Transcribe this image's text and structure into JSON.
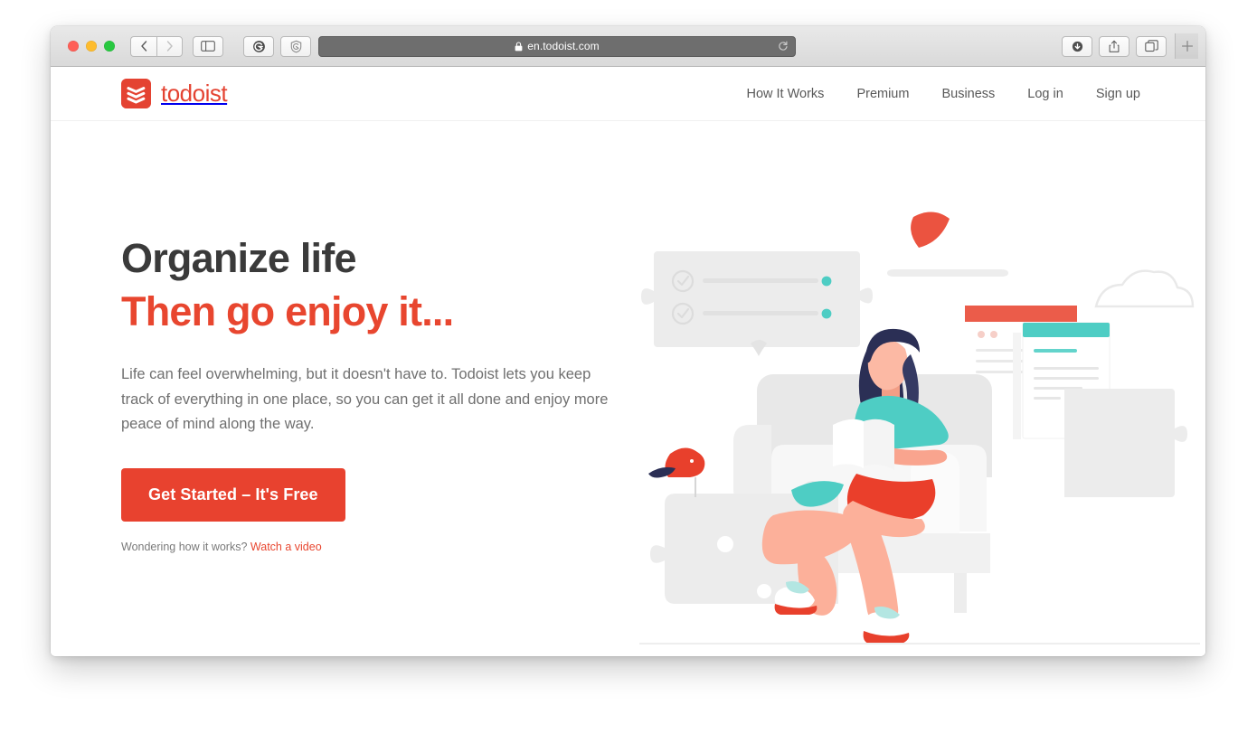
{
  "browser": {
    "url": "en.todoist.com",
    "lock_icon": "padlock-icon",
    "back_icon": "chevron-left-icon",
    "forward_icon": "chevron-right-icon",
    "sidebar_icon": "sidebar-toggle-icon",
    "extension_1_icon": "ghostery-g-icon",
    "extension_1_label": "G",
    "extension_2_icon": "shield-badge-icon",
    "reload_icon": "reload-icon",
    "downloads_icon": "downloads-arrow-icon",
    "share_icon": "share-up-arrow-icon",
    "tabs_icon": "show-all-tabs-icon",
    "newtab_icon": "plus-icon",
    "traffic_lights": [
      "close-button",
      "minimize-button",
      "zoom-button"
    ]
  },
  "site": {
    "brand": {
      "name": "todoist",
      "mark_icon": "todoist-logo-icon"
    },
    "nav": [
      {
        "label": "How It Works",
        "name": "nav-how-it-works"
      },
      {
        "label": "Premium",
        "name": "nav-premium"
      },
      {
        "label": "Business",
        "name": "nav-business"
      },
      {
        "label": "Log in",
        "name": "nav-log-in"
      },
      {
        "label": "Sign up",
        "name": "nav-sign-up"
      }
    ],
    "hero": {
      "headline_line1": "Organize life",
      "headline_line2": "Then go enjoy it...",
      "paragraph": "Life can feel overwhelming, but it doesn't have to. Todoist lets you keep track of everything in one place, so you can get it all done and enjoy more peace of mind along the way.",
      "cta_label": "Get Started – It's Free",
      "note_text": "Wondering how it works?",
      "note_link": "Watch a video",
      "illustration_name": "woman-reading-in-armchair-illustration"
    }
  },
  "colors": {
    "brand_red": "#e44332",
    "cta_red": "#e8422f",
    "headline_dark": "#3a3a3a",
    "body_gray": "#6f6f6f",
    "teal": "#4ecdc4",
    "hair_navy": "#2b2f55",
    "skin": "#f9a48e",
    "illustration_gray": "#ebebeb"
  }
}
